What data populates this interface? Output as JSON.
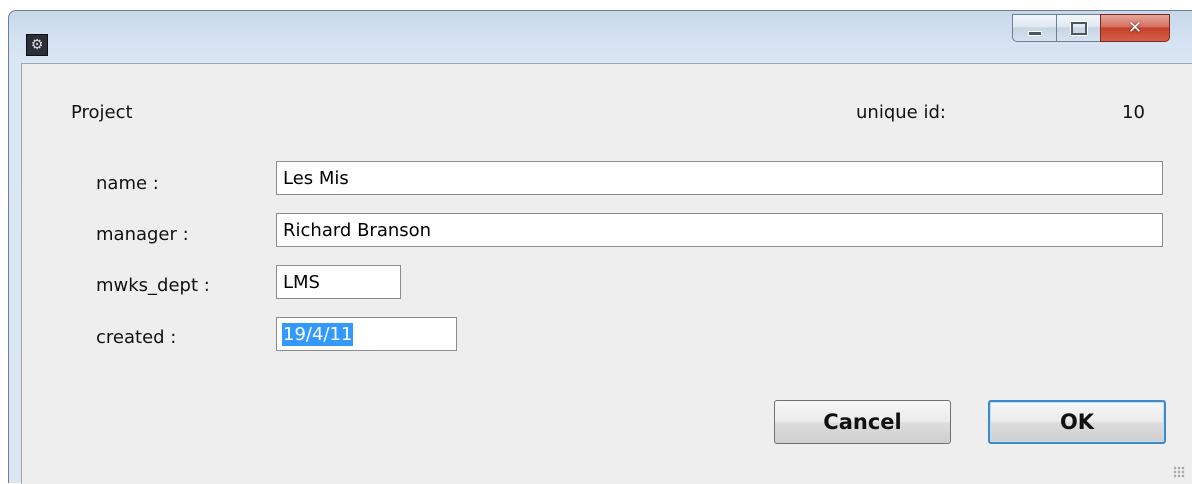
{
  "window": {
    "icon": "gear-icon",
    "controls": {
      "minimize": "minimize-icon",
      "maximize": "maximize-icon",
      "close": "✕"
    }
  },
  "form": {
    "heading": "Project",
    "unique_id_label": "unique id:",
    "unique_id_value": "10",
    "fields": {
      "name": {
        "label": "name :",
        "value": "Les Mis"
      },
      "manager": {
        "label": "manager :",
        "value": "Richard Branson"
      },
      "mwks_dept": {
        "label": "mwks_dept :",
        "value": "LMS"
      },
      "created": {
        "label": "created :",
        "value": "19/4/11"
      }
    }
  },
  "buttons": {
    "cancel": "Cancel",
    "ok": "OK"
  },
  "colors": {
    "selection": "#3399ff",
    "default_button_border": "#3c8bc8",
    "close_button": "#c4412c"
  }
}
